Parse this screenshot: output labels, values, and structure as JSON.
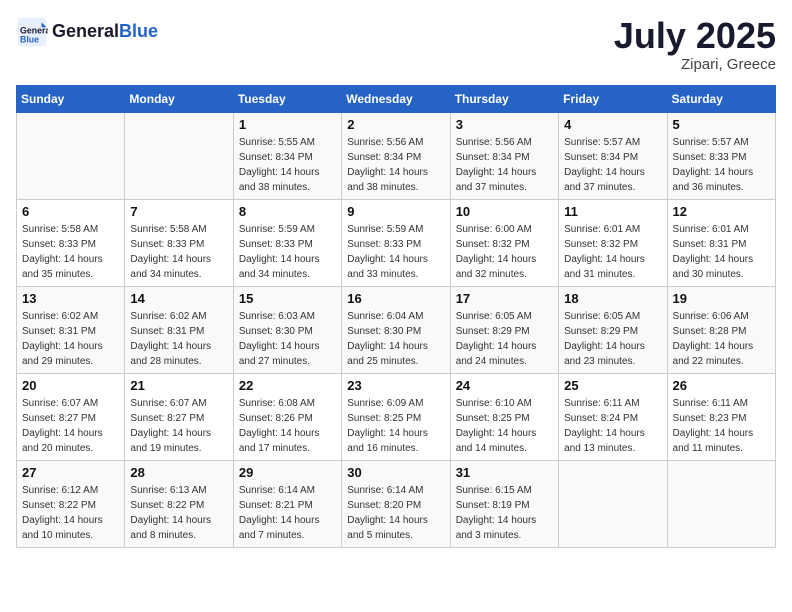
{
  "header": {
    "logo_general": "General",
    "logo_blue": "Blue",
    "month_year": "July 2025",
    "location": "Zipari, Greece"
  },
  "weekdays": [
    "Sunday",
    "Monday",
    "Tuesday",
    "Wednesday",
    "Thursday",
    "Friday",
    "Saturday"
  ],
  "weeks": [
    [
      {
        "day": "",
        "sunrise": "",
        "sunset": "",
        "daylight": ""
      },
      {
        "day": "",
        "sunrise": "",
        "sunset": "",
        "daylight": ""
      },
      {
        "day": "1",
        "sunrise": "Sunrise: 5:55 AM",
        "sunset": "Sunset: 8:34 PM",
        "daylight": "Daylight: 14 hours and 38 minutes."
      },
      {
        "day": "2",
        "sunrise": "Sunrise: 5:56 AM",
        "sunset": "Sunset: 8:34 PM",
        "daylight": "Daylight: 14 hours and 38 minutes."
      },
      {
        "day": "3",
        "sunrise": "Sunrise: 5:56 AM",
        "sunset": "Sunset: 8:34 PM",
        "daylight": "Daylight: 14 hours and 37 minutes."
      },
      {
        "day": "4",
        "sunrise": "Sunrise: 5:57 AM",
        "sunset": "Sunset: 8:34 PM",
        "daylight": "Daylight: 14 hours and 37 minutes."
      },
      {
        "day": "5",
        "sunrise": "Sunrise: 5:57 AM",
        "sunset": "Sunset: 8:33 PM",
        "daylight": "Daylight: 14 hours and 36 minutes."
      }
    ],
    [
      {
        "day": "6",
        "sunrise": "Sunrise: 5:58 AM",
        "sunset": "Sunset: 8:33 PM",
        "daylight": "Daylight: 14 hours and 35 minutes."
      },
      {
        "day": "7",
        "sunrise": "Sunrise: 5:58 AM",
        "sunset": "Sunset: 8:33 PM",
        "daylight": "Daylight: 14 hours and 34 minutes."
      },
      {
        "day": "8",
        "sunrise": "Sunrise: 5:59 AM",
        "sunset": "Sunset: 8:33 PM",
        "daylight": "Daylight: 14 hours and 34 minutes."
      },
      {
        "day": "9",
        "sunrise": "Sunrise: 5:59 AM",
        "sunset": "Sunset: 8:33 PM",
        "daylight": "Daylight: 14 hours and 33 minutes."
      },
      {
        "day": "10",
        "sunrise": "Sunrise: 6:00 AM",
        "sunset": "Sunset: 8:32 PM",
        "daylight": "Daylight: 14 hours and 32 minutes."
      },
      {
        "day": "11",
        "sunrise": "Sunrise: 6:01 AM",
        "sunset": "Sunset: 8:32 PM",
        "daylight": "Daylight: 14 hours and 31 minutes."
      },
      {
        "day": "12",
        "sunrise": "Sunrise: 6:01 AM",
        "sunset": "Sunset: 8:31 PM",
        "daylight": "Daylight: 14 hours and 30 minutes."
      }
    ],
    [
      {
        "day": "13",
        "sunrise": "Sunrise: 6:02 AM",
        "sunset": "Sunset: 8:31 PM",
        "daylight": "Daylight: 14 hours and 29 minutes."
      },
      {
        "day": "14",
        "sunrise": "Sunrise: 6:02 AM",
        "sunset": "Sunset: 8:31 PM",
        "daylight": "Daylight: 14 hours and 28 minutes."
      },
      {
        "day": "15",
        "sunrise": "Sunrise: 6:03 AM",
        "sunset": "Sunset: 8:30 PM",
        "daylight": "Daylight: 14 hours and 27 minutes."
      },
      {
        "day": "16",
        "sunrise": "Sunrise: 6:04 AM",
        "sunset": "Sunset: 8:30 PM",
        "daylight": "Daylight: 14 hours and 25 minutes."
      },
      {
        "day": "17",
        "sunrise": "Sunrise: 6:05 AM",
        "sunset": "Sunset: 8:29 PM",
        "daylight": "Daylight: 14 hours and 24 minutes."
      },
      {
        "day": "18",
        "sunrise": "Sunrise: 6:05 AM",
        "sunset": "Sunset: 8:29 PM",
        "daylight": "Daylight: 14 hours and 23 minutes."
      },
      {
        "day": "19",
        "sunrise": "Sunrise: 6:06 AM",
        "sunset": "Sunset: 8:28 PM",
        "daylight": "Daylight: 14 hours and 22 minutes."
      }
    ],
    [
      {
        "day": "20",
        "sunrise": "Sunrise: 6:07 AM",
        "sunset": "Sunset: 8:27 PM",
        "daylight": "Daylight: 14 hours and 20 minutes."
      },
      {
        "day": "21",
        "sunrise": "Sunrise: 6:07 AM",
        "sunset": "Sunset: 8:27 PM",
        "daylight": "Daylight: 14 hours and 19 minutes."
      },
      {
        "day": "22",
        "sunrise": "Sunrise: 6:08 AM",
        "sunset": "Sunset: 8:26 PM",
        "daylight": "Daylight: 14 hours and 17 minutes."
      },
      {
        "day": "23",
        "sunrise": "Sunrise: 6:09 AM",
        "sunset": "Sunset: 8:25 PM",
        "daylight": "Daylight: 14 hours and 16 minutes."
      },
      {
        "day": "24",
        "sunrise": "Sunrise: 6:10 AM",
        "sunset": "Sunset: 8:25 PM",
        "daylight": "Daylight: 14 hours and 14 minutes."
      },
      {
        "day": "25",
        "sunrise": "Sunrise: 6:11 AM",
        "sunset": "Sunset: 8:24 PM",
        "daylight": "Daylight: 14 hours and 13 minutes."
      },
      {
        "day": "26",
        "sunrise": "Sunrise: 6:11 AM",
        "sunset": "Sunset: 8:23 PM",
        "daylight": "Daylight: 14 hours and 11 minutes."
      }
    ],
    [
      {
        "day": "27",
        "sunrise": "Sunrise: 6:12 AM",
        "sunset": "Sunset: 8:22 PM",
        "daylight": "Daylight: 14 hours and 10 minutes."
      },
      {
        "day": "28",
        "sunrise": "Sunrise: 6:13 AM",
        "sunset": "Sunset: 8:22 PM",
        "daylight": "Daylight: 14 hours and 8 minutes."
      },
      {
        "day": "29",
        "sunrise": "Sunrise: 6:14 AM",
        "sunset": "Sunset: 8:21 PM",
        "daylight": "Daylight: 14 hours and 7 minutes."
      },
      {
        "day": "30",
        "sunrise": "Sunrise: 6:14 AM",
        "sunset": "Sunset: 8:20 PM",
        "daylight": "Daylight: 14 hours and 5 minutes."
      },
      {
        "day": "31",
        "sunrise": "Sunrise: 6:15 AM",
        "sunset": "Sunset: 8:19 PM",
        "daylight": "Daylight: 14 hours and 3 minutes."
      },
      {
        "day": "",
        "sunrise": "",
        "sunset": "",
        "daylight": ""
      },
      {
        "day": "",
        "sunrise": "",
        "sunset": "",
        "daylight": ""
      }
    ]
  ]
}
